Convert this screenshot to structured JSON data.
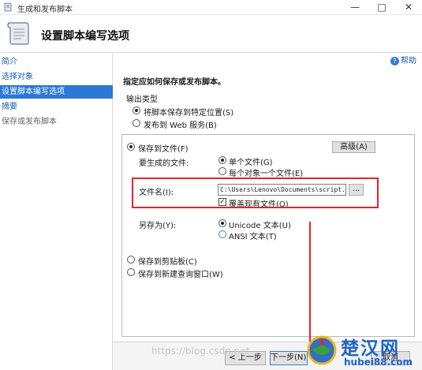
{
  "window": {
    "title": "生成和发布脚本"
  },
  "header": {
    "title": "设置脚本编写选项"
  },
  "help": {
    "label": "帮助"
  },
  "sidebar": {
    "items": [
      {
        "label": "简介"
      },
      {
        "label": "选择对象"
      },
      {
        "label": "设置脚本编写选项"
      },
      {
        "label": "摘要"
      },
      {
        "label": "保存或发布脚本"
      }
    ]
  },
  "main": {
    "instruction": "指定应如何保存或发布脚本。",
    "output_type_label": "输出类型",
    "save_to_location": "将脚本保存到特定位置(S)",
    "publish_web": "发布到 Web 服务(B)",
    "save_to_file": "保存到文件(F)",
    "advanced_button": "高级(A)",
    "files_to_generate_label": "要生成的文件:",
    "single_file": "单个文件(G)",
    "file_per_object": "每个对象一个文件(E)",
    "filename_label": "文件名(I):",
    "filename_value": "C:\\Users\\Lenovo\\Documents\\script.sq",
    "browse_button": "...",
    "overwrite": "覆盖现有文件(O)",
    "save_as_label": "另存为(Y):",
    "unicode_text": "Unicode 文本(U)",
    "ansi_text": "ANSI 文本(T)",
    "save_to_clipboard": "保存到剪贴板(C)",
    "save_to_query_window": "保存到新建查询窗口(W)"
  },
  "footer": {
    "prev_button": "< 上一步",
    "next_button": "下一步(N) >",
    "cancel_button": "取消"
  },
  "watermark": {
    "url_text": "https://blog.csdn.net",
    "site_name": "楚汉网",
    "site_url": "hubei88.com"
  },
  "colors": {
    "accent": "#2b78d6",
    "annotation": "#e8232a",
    "link": "#1c5fb0"
  }
}
